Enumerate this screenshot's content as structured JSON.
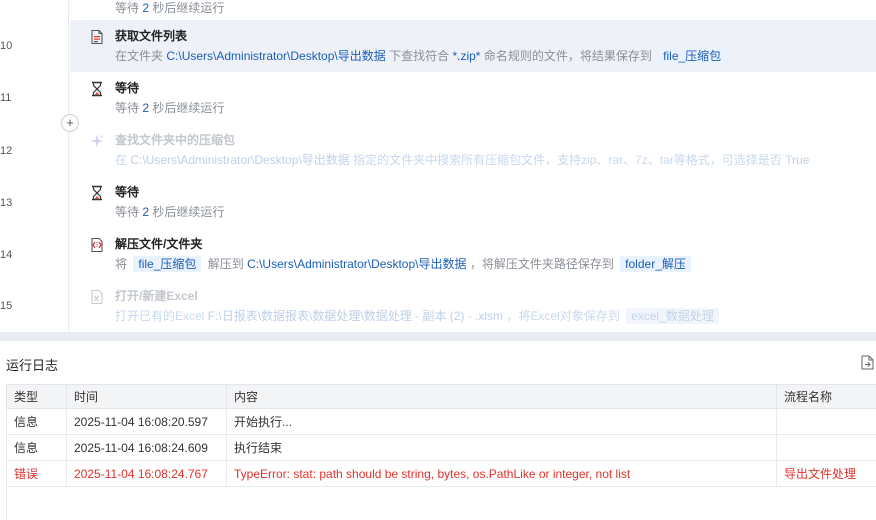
{
  "flow": {
    "line_numbers": [
      "10",
      "11",
      "12",
      "13",
      "14",
      "15"
    ],
    "top_step_partial": {
      "prefix": "等待",
      "num": "2",
      "suffix": "秒后继续运行"
    },
    "steps": [
      {
        "title": "获取文件列表",
        "icon": "file-list-icon",
        "desc_parts": [
          "在文件夹",
          "C:\\Users\\Administrator\\Desktop\\导出数据",
          "下查找符合",
          "*.zip*",
          "命名规则的文件，将结果保存到",
          "file_压缩包"
        ]
      },
      {
        "title": "等待",
        "icon": "hourglass-icon",
        "desc_parts": [
          "等待",
          "2",
          "秒后继续运行"
        ]
      },
      {
        "title": "查找文件夹中的压缩包",
        "icon": "sparkle-icon",
        "desc_parts": [
          "在",
          "C:\\Users\\Administrator\\Desktop\\导出数据",
          "指定的文件夹中搜索所有压缩包文件，支持zip、rar、7z、tar等格式，可选择是否",
          "True"
        ]
      },
      {
        "title": "等待",
        "icon": "hourglass-icon",
        "desc_parts": [
          "等待",
          "2",
          "秒后继续运行"
        ]
      },
      {
        "title": "解压文件/文件夹",
        "icon": "unzip-icon",
        "desc_parts": [
          "将",
          "file_压缩包",
          "解压到",
          "C:\\Users\\Administrator\\Desktop\\导出数据",
          "，将解压文件夹路径保存到",
          "folder_解压"
        ]
      },
      {
        "title": "打开/新建Excel",
        "icon": "excel-file-icon",
        "desc_parts": [
          "打开已有的Excel",
          "F:\\日报表\\数据报表\\数据处理\\数据处理 - 副本 (2) - .xlsm",
          "，将Excel对象保存到",
          "excel_数据处理"
        ]
      }
    ],
    "add_button": "+"
  },
  "log": {
    "title": "运行日志",
    "columns": [
      "类型",
      "时间",
      "内容",
      "流程名称"
    ],
    "rows": [
      {
        "type": "信息",
        "time": "2025-11-04 16:08:20.597",
        "content": "开始执行...",
        "process": ""
      },
      {
        "type": "信息",
        "time": "2025-11-04 16:08:24.609",
        "content": "执行结束",
        "process": ""
      },
      {
        "type": "错误",
        "time": "2025-11-04 16:08:24.767",
        "content": "TypeError: stat: path should be string, bytes, os.PathLike or integer, not list",
        "process": "导出文件处理"
      }
    ]
  },
  "colors": {
    "selected_row": "#eef2f8",
    "path_blue": "#1b5fb8",
    "error_red": "#e0322b",
    "divider": "#e9ecf1"
  }
}
